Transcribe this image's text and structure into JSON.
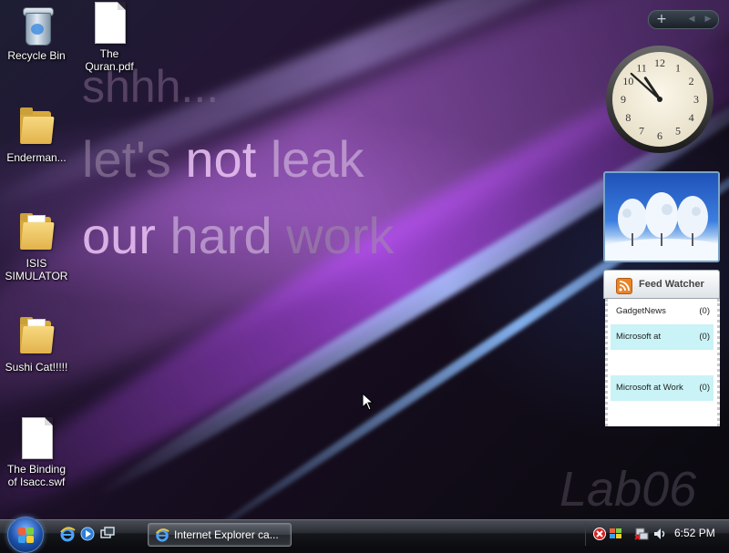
{
  "wallpaper": {
    "line1": "shhh...",
    "line2": {
      "a": "let's ",
      "b": "not",
      "c": " leak"
    },
    "line3": {
      "a": "our ",
      "b": "hard",
      "c": " work"
    },
    "watermark": "Lab06"
  },
  "desktop_icons": [
    {
      "label": "Recycle Bin",
      "icon": "recycle-bin-icon"
    },
    {
      "label": "The Quran.pdf",
      "icon": "document-icon"
    },
    {
      "label": "Enderman...",
      "icon": "folder-icon"
    },
    {
      "label": "ISIS SIMULATOR",
      "icon": "folder-icon"
    },
    {
      "label": "Sushi Cat!!!!!",
      "icon": "folder-icon"
    },
    {
      "label": "The Binding of Isacc.swf",
      "icon": "document-icon"
    }
  ],
  "sidebar": {
    "add_label": "+",
    "prev_label": "◀",
    "next_label": "▶",
    "clock": {
      "hour": 10,
      "minute": 52
    },
    "feed_watcher": {
      "title": "Feed Watcher",
      "feeds": [
        {
          "name": "GadgetNews",
          "count": "(0)",
          "highlighted": false
        },
        {
          "name": "Microsoft at",
          "count": "(0)",
          "highlighted": true
        },
        {
          "name": "",
          "count": "",
          "highlighted": false
        },
        {
          "name": "Microsoft at Work",
          "count": "(0)",
          "highlighted": true
        }
      ]
    }
  },
  "taskbar": {
    "task_ie_label": "Internet Explorer ca...",
    "time": "6:52 PM"
  },
  "colors": {
    "accent": "#b070e0",
    "feed_highlight": "#c9f3f6",
    "taskbar": "#14161a"
  }
}
